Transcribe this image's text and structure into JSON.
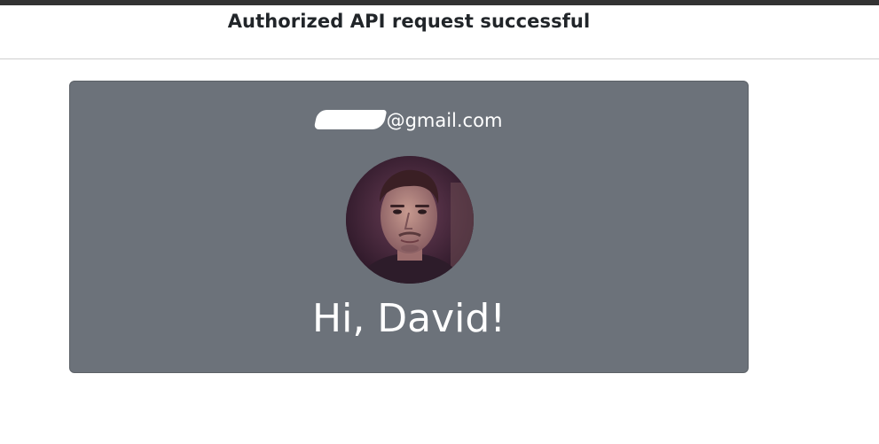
{
  "header": {
    "title": "Authorized API request successful"
  },
  "profile": {
    "email_suffix": "@gmail.com",
    "greeting": "Hi, David!",
    "avatar_icon": "user-photo"
  },
  "colors": {
    "card_bg": "#6c727a",
    "top_bar": "#333333"
  }
}
